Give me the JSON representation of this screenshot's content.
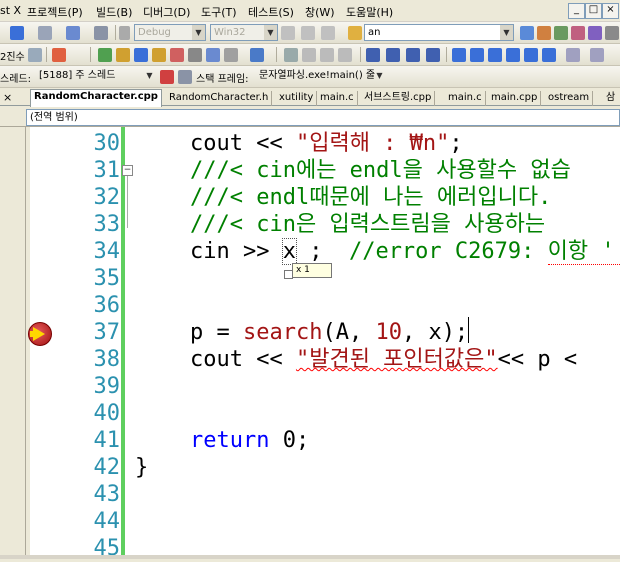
{
  "menu": {
    "items": [
      "st X",
      "프로젝트(P)",
      "빌드(B)",
      "디버그(D)",
      "도구(T)",
      "테스트(S)",
      "창(W)",
      "도움말(H)"
    ]
  },
  "toolbar1": {
    "config_value": "Debug",
    "platform_value": "Win32",
    "find_value": "an"
  },
  "toolbar2": {
    "left_label": "2진수"
  },
  "toolbar3": {
    "thread_label": "스레드:",
    "thread_value": "[5188] 주 스레드",
    "stack_label": "스택 프레임:",
    "stack_value": "문자열파싱.exe!main() 줄"
  },
  "tabs": [
    {
      "label": "RandomCharacter.cpp",
      "active": true
    },
    {
      "label": "RandomCharacter.h",
      "active": false
    },
    {
      "label": "xutility",
      "active": false
    },
    {
      "label": "main.c",
      "active": false
    },
    {
      "label": "서브스트링.cpp",
      "active": false
    },
    {
      "label": "main.c",
      "active": false
    },
    {
      "label": "main.cpp",
      "active": false
    },
    {
      "label": "ostream",
      "active": false
    },
    {
      "label": "삼",
      "active": false
    }
  ],
  "scope": {
    "value": "(전역 범위)"
  },
  "editor": {
    "line_numbers": [
      "30",
      "31",
      "32",
      "33",
      "34",
      "35",
      "36",
      "37",
      "38",
      "39",
      "40",
      "41",
      "42",
      "43",
      "44",
      "45"
    ],
    "lines": {
      "l30_a": "cout << ",
      "l30_b": "\"입력해 : ₩n\"",
      "l30_c": ";",
      "l31": "///< cin에는 endl을 사용할수 없습",
      "l32": "///< endl때문에 나는 에러입니다.",
      "l33": "///< cin은 입력스트림을 사용하는",
      "l34_a": "cin >> ",
      "l34_b": "x",
      "l34_c": " ;  ",
      "l34_d": "//error C2679: 이항 '",
      "l37_a": "p = ",
      "l37_b": "search",
      "l37_c": "(A, ",
      "l37_d": "10",
      "l37_e": ", x);",
      "l38_a": "cout << ",
      "l38_b": "\"발견된 포인터값은\"",
      "l38_c": "<< p <",
      "l41_a": "return",
      "l41_b": " 0;",
      "l42": "}"
    },
    "datatip": "x 1"
  },
  "colors": {
    "keyword": "#0000ff",
    "string": "#a31515",
    "comment": "#008000",
    "line_number": "#2b91af",
    "change_bar": "#5fcf5f"
  }
}
